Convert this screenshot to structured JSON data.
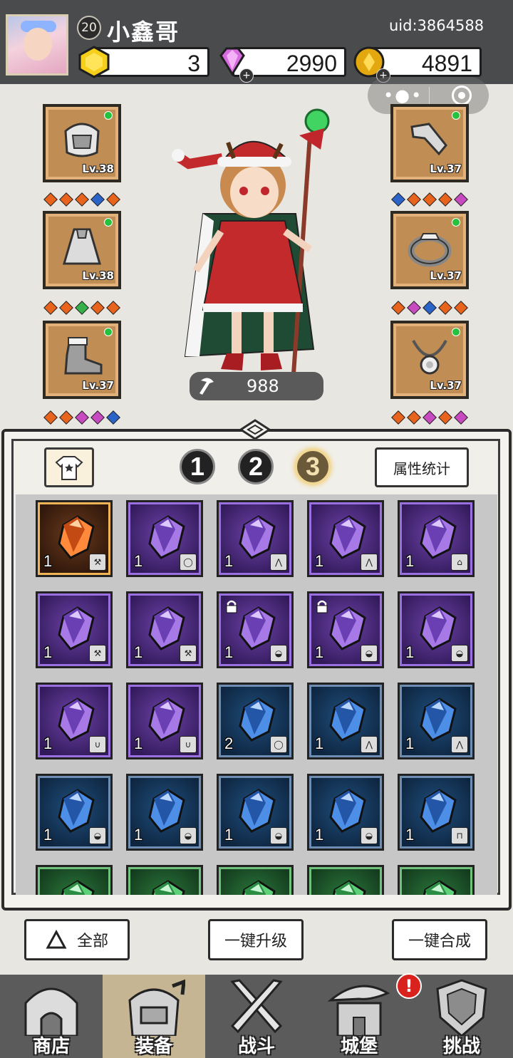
{
  "header": {
    "level": "20",
    "username": "小鑫哥",
    "uid": "uid:3864588",
    "resources": [
      {
        "name": "gold-hex",
        "value": "3"
      },
      {
        "name": "diamond",
        "value": "2990"
      },
      {
        "name": "coin",
        "value": "4891"
      }
    ]
  },
  "equipment": {
    "left": [
      {
        "item": "helmet-icon",
        "level": "Lv.38",
        "gems": [
          "#e8641c",
          "#e8641c",
          "#e8641c",
          "#2a64c8",
          "#e8641c"
        ]
      },
      {
        "item": "cape-icon",
        "level": "Lv.38",
        "gems": [
          "#e8641c",
          "#e8641c",
          "#35b04a",
          "#e8641c",
          "#e8641c"
        ]
      },
      {
        "item": "boot-icon",
        "level": "Lv.37",
        "gems": [
          "#e8641c",
          "#e8641c",
          "#c84ac0",
          "#c84ac0",
          "#2a64c8"
        ]
      }
    ],
    "right": [
      {
        "item": "bracer-icon",
        "level": "Lv.37",
        "gems": [
          "#2a64c8",
          "#e8641c",
          "#e8641c",
          "#e8641c",
          "#c84ac0"
        ]
      },
      {
        "item": "ring-icon",
        "level": "Lv.37",
        "gems": [
          "#e8641c",
          "#c84ac0",
          "#2a64c8",
          "#e8641c",
          "#e8641c"
        ]
      },
      {
        "item": "necklace-icon",
        "level": "Lv.37",
        "gems": [
          "#e8641c",
          "#e8641c",
          "#c84ac0",
          "#e8641c",
          "#c84ac0"
        ]
      }
    ]
  },
  "power": "988",
  "inventory": {
    "tabs": [
      "1",
      "2",
      "3"
    ],
    "active_tab": "3",
    "attr_button": "属性统计",
    "items": [
      {
        "rarity": "orange",
        "count": "1",
        "tag": "staff",
        "locked": false
      },
      {
        "rarity": "purple",
        "count": "1",
        "tag": "ring",
        "locked": false
      },
      {
        "rarity": "purple",
        "count": "1",
        "tag": "cape",
        "locked": false
      },
      {
        "rarity": "purple",
        "count": "1",
        "tag": "cape",
        "locked": false
      },
      {
        "rarity": "purple",
        "count": "1",
        "tag": "boot",
        "locked": false
      },
      {
        "rarity": "purple",
        "count": "1",
        "tag": "staff",
        "locked": false
      },
      {
        "rarity": "purple",
        "count": "1",
        "tag": "staff",
        "locked": false
      },
      {
        "rarity": "purple",
        "count": "1",
        "tag": "helmet",
        "locked": true
      },
      {
        "rarity": "purple",
        "count": "1",
        "tag": "helmet",
        "locked": true
      },
      {
        "rarity": "purple",
        "count": "1",
        "tag": "helmet",
        "locked": false
      },
      {
        "rarity": "purple",
        "count": "1",
        "tag": "necklace",
        "locked": false
      },
      {
        "rarity": "purple",
        "count": "1",
        "tag": "necklace",
        "locked": false
      },
      {
        "rarity": "blue",
        "count": "2",
        "tag": "ring",
        "locked": false
      },
      {
        "rarity": "blue",
        "count": "1",
        "tag": "cape",
        "locked": false
      },
      {
        "rarity": "blue",
        "count": "1",
        "tag": "cape",
        "locked": false
      },
      {
        "rarity": "blue",
        "count": "1",
        "tag": "helmet",
        "locked": false
      },
      {
        "rarity": "blue",
        "count": "1",
        "tag": "helmet",
        "locked": false
      },
      {
        "rarity": "blue",
        "count": "1",
        "tag": "helmet",
        "locked": false
      },
      {
        "rarity": "blue",
        "count": "1",
        "tag": "helmet",
        "locked": false
      },
      {
        "rarity": "blue",
        "count": "1",
        "tag": "bracer",
        "locked": false
      },
      {
        "rarity": "green",
        "count": "",
        "tag": "",
        "locked": false
      },
      {
        "rarity": "green",
        "count": "",
        "tag": "",
        "locked": false
      },
      {
        "rarity": "green",
        "count": "",
        "tag": "",
        "locked": false
      },
      {
        "rarity": "green",
        "count": "",
        "tag": "",
        "locked": false
      },
      {
        "rarity": "green",
        "count": "",
        "tag": "",
        "locked": false
      }
    ]
  },
  "actions": {
    "all": "全部",
    "upgrade_all": "一键升级",
    "merge_all": "一键合成"
  },
  "nav": [
    {
      "label": "商店",
      "icon": "shop-icon"
    },
    {
      "label": "装备",
      "icon": "equipment-bag-icon"
    },
    {
      "label": "战斗",
      "icon": "crossed-swords-icon"
    },
    {
      "label": "城堡",
      "icon": "castle-icon"
    },
    {
      "label": "挑战",
      "icon": "shield-icon"
    }
  ],
  "nav_active": "装备",
  "alert_badge": "!"
}
